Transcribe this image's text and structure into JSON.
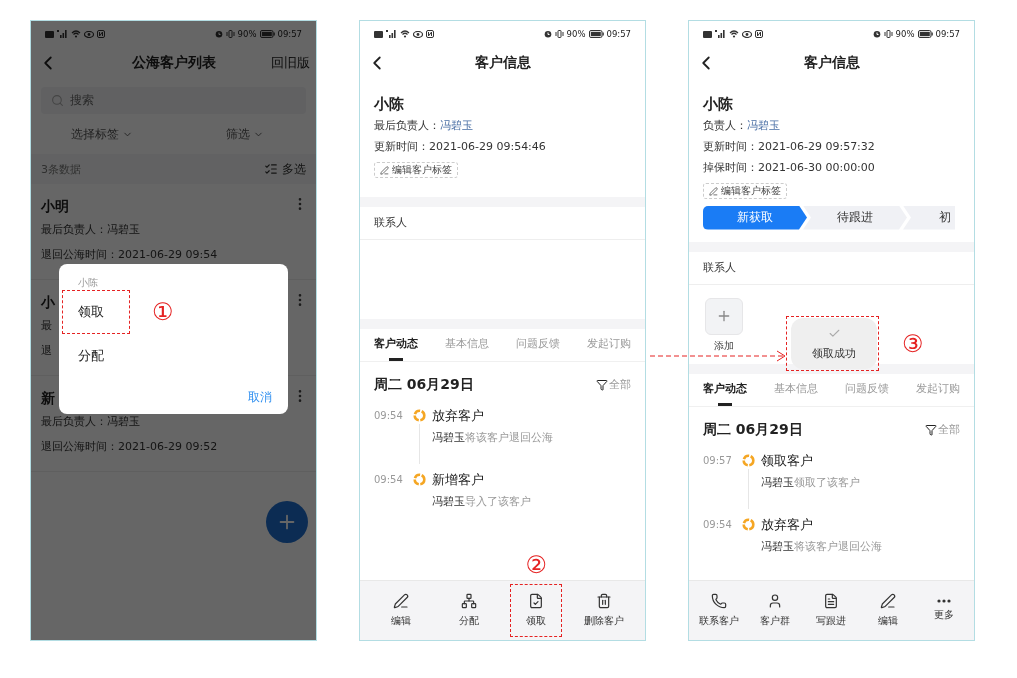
{
  "phones": [
    {
      "kind": "list",
      "status_bar": {
        "battery": "90%",
        "time": "09:57"
      },
      "header": {
        "title": "公海客户列表",
        "action": "回旧版"
      },
      "search": {
        "placeholder": "搜索"
      },
      "filters": [
        "选择标签",
        "筛选"
      ],
      "summary": {
        "count": "3条数据",
        "action": "多选"
      },
      "customers": [
        {
          "name": "小明",
          "lines": [
            "最后负责人：冯碧玉",
            "退回公海时间：2021-06-29 09:54"
          ]
        },
        {
          "name": "小",
          "lines": [
            "最",
            "退"
          ]
        },
        {
          "name": "新",
          "lines": [
            "最后负责人：冯碧玉",
            "退回公海时间：2021-06-29 09:52"
          ]
        }
      ],
      "dialog": {
        "title": "小陈",
        "options": [
          {
            "label": "领取",
            "annotated": true,
            "marker": "①"
          },
          {
            "label": "分配",
            "annotated": false
          }
        ],
        "cancel": "取消"
      }
    },
    {
      "kind": "detail",
      "status_bar": {
        "battery": "90%",
        "time": "09:57"
      },
      "header": {
        "title": "客户信息"
      },
      "customer": {
        "name": "小陈",
        "fields": [
          {
            "label": "最后负责人：",
            "value": "冯碧玉",
            "kind": "person"
          },
          {
            "label": "更新时间：",
            "value": "2021-06-29 09:54:46",
            "kind": "text"
          }
        ],
        "tag_button": "编辑客户标签"
      },
      "contacts": {
        "title": "联系人"
      },
      "tabs": [
        {
          "label": "客户动态",
          "selected": true
        },
        {
          "label": "基本信息",
          "selected": false
        },
        {
          "label": "问题反馈",
          "selected": false
        },
        {
          "label": "发起订购",
          "selected": false
        }
      ],
      "timeline": {
        "date": "周二 06月29日",
        "filter": "全部",
        "events": [
          {
            "time": "09:54",
            "title": "放弃客户",
            "text": "**冯碧玉**将该客户退回公海"
          },
          {
            "time": "09:54",
            "title": "新增客户",
            "text": "**冯碧玉**导入了该客户"
          }
        ]
      },
      "actions": [
        {
          "label": "编辑",
          "kind": "edit",
          "annotated": false
        },
        {
          "label": "分配",
          "kind": "assign",
          "annotated": false
        },
        {
          "label": "领取",
          "kind": "claim",
          "annotated": true,
          "marker": "②"
        },
        {
          "label": "删除客户",
          "kind": "delete",
          "annotated": false
        }
      ]
    },
    {
      "kind": "detail",
      "status_bar": {
        "battery": "90%",
        "time": "09:57"
      },
      "header": {
        "title": "客户信息"
      },
      "customer": {
        "name": "小陈",
        "fields": [
          {
            "label": "负责人：",
            "value": "冯碧玉",
            "kind": "person"
          },
          {
            "label": "更新时间：",
            "value": "2021-06-29 09:57:32",
            "kind": "text"
          },
          {
            "label": "掉保时间：",
            "value": "2021-06-30 00:00:00",
            "kind": "text"
          }
        ],
        "tag_button": "编辑客户标签",
        "stages": [
          {
            "label": "新获取",
            "selected": true
          },
          {
            "label": "待跟进",
            "selected": false
          },
          {
            "label": "初",
            "selected": false
          }
        ]
      },
      "contacts": {
        "title": "联系人",
        "add": "添加"
      },
      "toast": {
        "text": "领取成功",
        "annotated": true,
        "marker": "③"
      },
      "tabs": [
        {
          "label": "客户动态",
          "selected": true
        },
        {
          "label": "基本信息",
          "selected": false
        },
        {
          "label": "问题反馈",
          "selected": false
        },
        {
          "label": "发起订购",
          "selected": false
        }
      ],
      "timeline": {
        "date": "周二 06月29日",
        "filter": "全部",
        "events": [
          {
            "time": "09:57",
            "title": "领取客户",
            "text": "**冯碧玉**领取了该客户"
          },
          {
            "time": "09:54",
            "title": "放弃客户",
            "text": "**冯碧玉**将该客户退回公海"
          }
        ]
      },
      "actions": [
        {
          "label": "联系客户",
          "kind": "call",
          "annotated": false
        },
        {
          "label": "客户群",
          "kind": "group",
          "annotated": false
        },
        {
          "label": "写跟进",
          "kind": "note",
          "annotated": false
        },
        {
          "label": "编辑",
          "kind": "edit",
          "annotated": false
        },
        {
          "label": "更多",
          "kind": "more",
          "annotated": false
        }
      ]
    }
  ]
}
